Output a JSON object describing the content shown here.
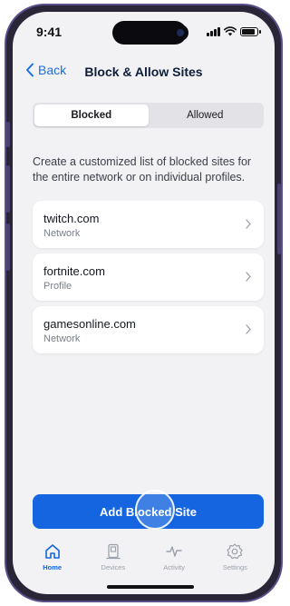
{
  "status_bar": {
    "time": "9:41"
  },
  "nav": {
    "back_label": "Back",
    "title": "Block & Allow Sites"
  },
  "segmented": {
    "options": [
      "Blocked",
      "Allowed"
    ],
    "selected": "Blocked"
  },
  "description": "Create a customized list of blocked sites for the entire network or on individual profiles.",
  "sites": [
    {
      "domain": "twitch.com",
      "scope": "Network"
    },
    {
      "domain": "fortnite.com",
      "scope": "Profile"
    },
    {
      "domain": "gamesonline.com",
      "scope": "Network"
    }
  ],
  "add_button_label": "Add Blocked Site",
  "tabs": [
    {
      "label": "Home",
      "icon": "home-icon",
      "active": true
    },
    {
      "label": "Devices",
      "icon": "devices-icon",
      "active": false
    },
    {
      "label": "Activity",
      "icon": "activity-icon",
      "active": false
    },
    {
      "label": "Settings",
      "icon": "settings-icon",
      "active": false
    }
  ],
  "colors": {
    "accent": "#1565e0",
    "link": "#1a6fe0",
    "frame": "#5b4f8a",
    "background": "#f2f2f4"
  }
}
